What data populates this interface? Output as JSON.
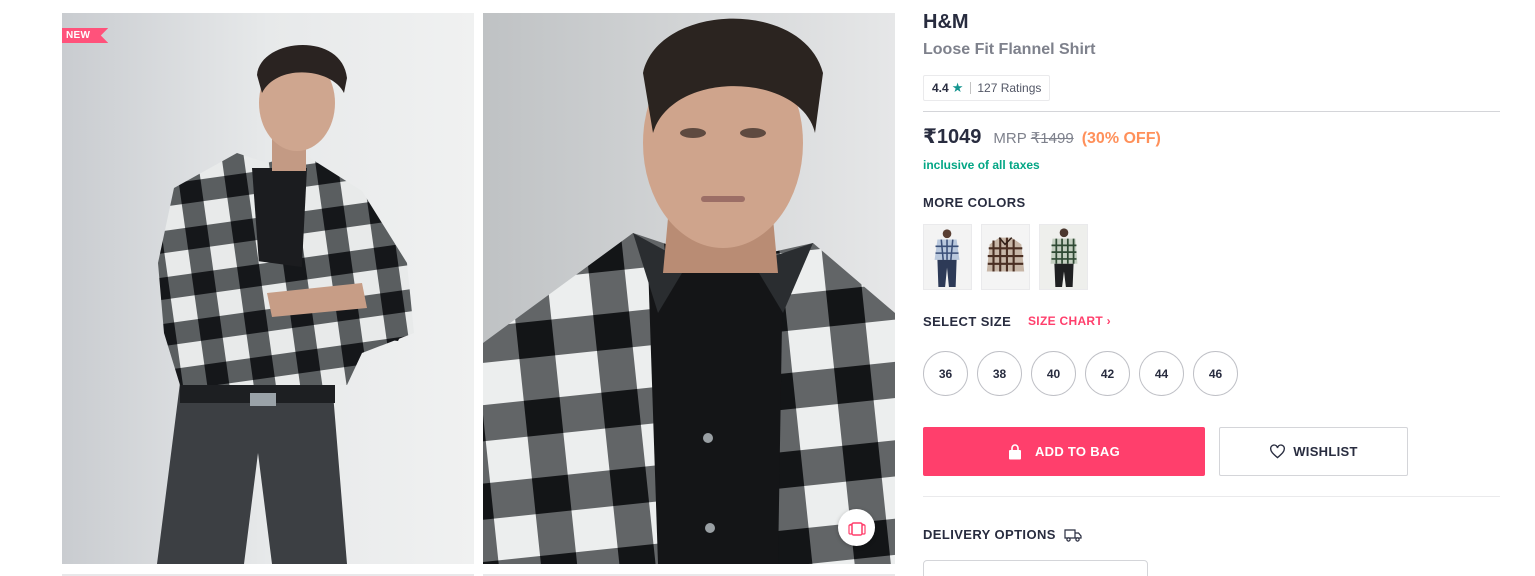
{
  "gallery": {
    "new_tag": "NEW",
    "images": [
      {
        "icon": "model-photo-arms-crossed"
      },
      {
        "icon": "model-photo-closeup"
      }
    ],
    "similar_button_icon": "similar-products-icon"
  },
  "product": {
    "brand": "H&M",
    "name": "Loose Fit Flannel Shirt",
    "rating": {
      "value": "4.4",
      "star_icon": "★",
      "count_text": "127 Ratings"
    },
    "price": {
      "selling": "₹1049",
      "mrp_label": "MRP",
      "mrp_value": "₹1499",
      "discount": "(30% OFF)",
      "tax_note": "inclusive of all taxes"
    },
    "colors_title": "MORE COLORS",
    "color_swatches": [
      {
        "icon": "blue-check-shirt-thumbnail"
      },
      {
        "icon": "brown-check-shirt-thumbnail"
      },
      {
        "icon": "green-check-shirt-thumbnail"
      }
    ],
    "size_title": "SELECT SIZE",
    "size_chart_label": "SIZE CHART",
    "size_chart_chevron": "›",
    "sizes": [
      "36",
      "38",
      "40",
      "42",
      "44",
      "46"
    ],
    "add_to_bag_label": "ADD TO BAG",
    "wishlist_label": "WISHLIST",
    "delivery_title": "DELIVERY OPTIONS"
  },
  "colors": {
    "accent": "#ff3f6c",
    "discount": "#ff905a",
    "tax_green": "#03a685",
    "rating_star": "#14958f"
  }
}
